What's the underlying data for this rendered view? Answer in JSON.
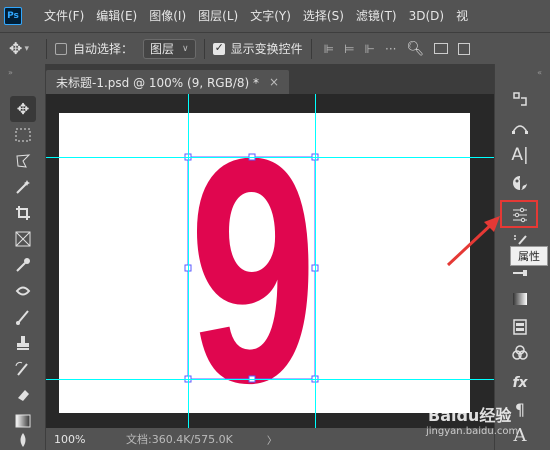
{
  "app": {
    "logo_text": "Ps",
    "menu": [
      "文件(F)",
      "编辑(E)",
      "图像(I)",
      "图层(L)",
      "文字(Y)",
      "选择(S)",
      "滤镜(T)",
      "3D(D)",
      "视"
    ]
  },
  "options": {
    "auto_select_label": "自动选择：",
    "auto_select_checked": false,
    "layer_select_value": "图层",
    "show_transform_label": "显示变换控件",
    "show_transform_checked": true
  },
  "document": {
    "tab_title": "未标题-1.psd @ 100% (9, RGB/8) *",
    "glyph": "9",
    "glyph_color": "#e0064f",
    "guide_color": "#00ffff",
    "zoom": "100%",
    "doc_info": "文档:360.4K/575.0K"
  },
  "right_panel": {
    "icons": [
      "history-icon",
      "paths-icon",
      "character-icon",
      "swatches-icon",
      "properties-icon",
      "adjustments-icon",
      "layer-comps-icon",
      "gradient-icon",
      "channels-icon",
      "color-circles-icon",
      "styles-icon",
      "paragraph-icon",
      "type-icon"
    ],
    "tooltip": "属性",
    "highlight_color": "#e53935"
  },
  "watermark": {
    "text": "Baidu经验",
    "url": "jingyan.baidu.com"
  }
}
